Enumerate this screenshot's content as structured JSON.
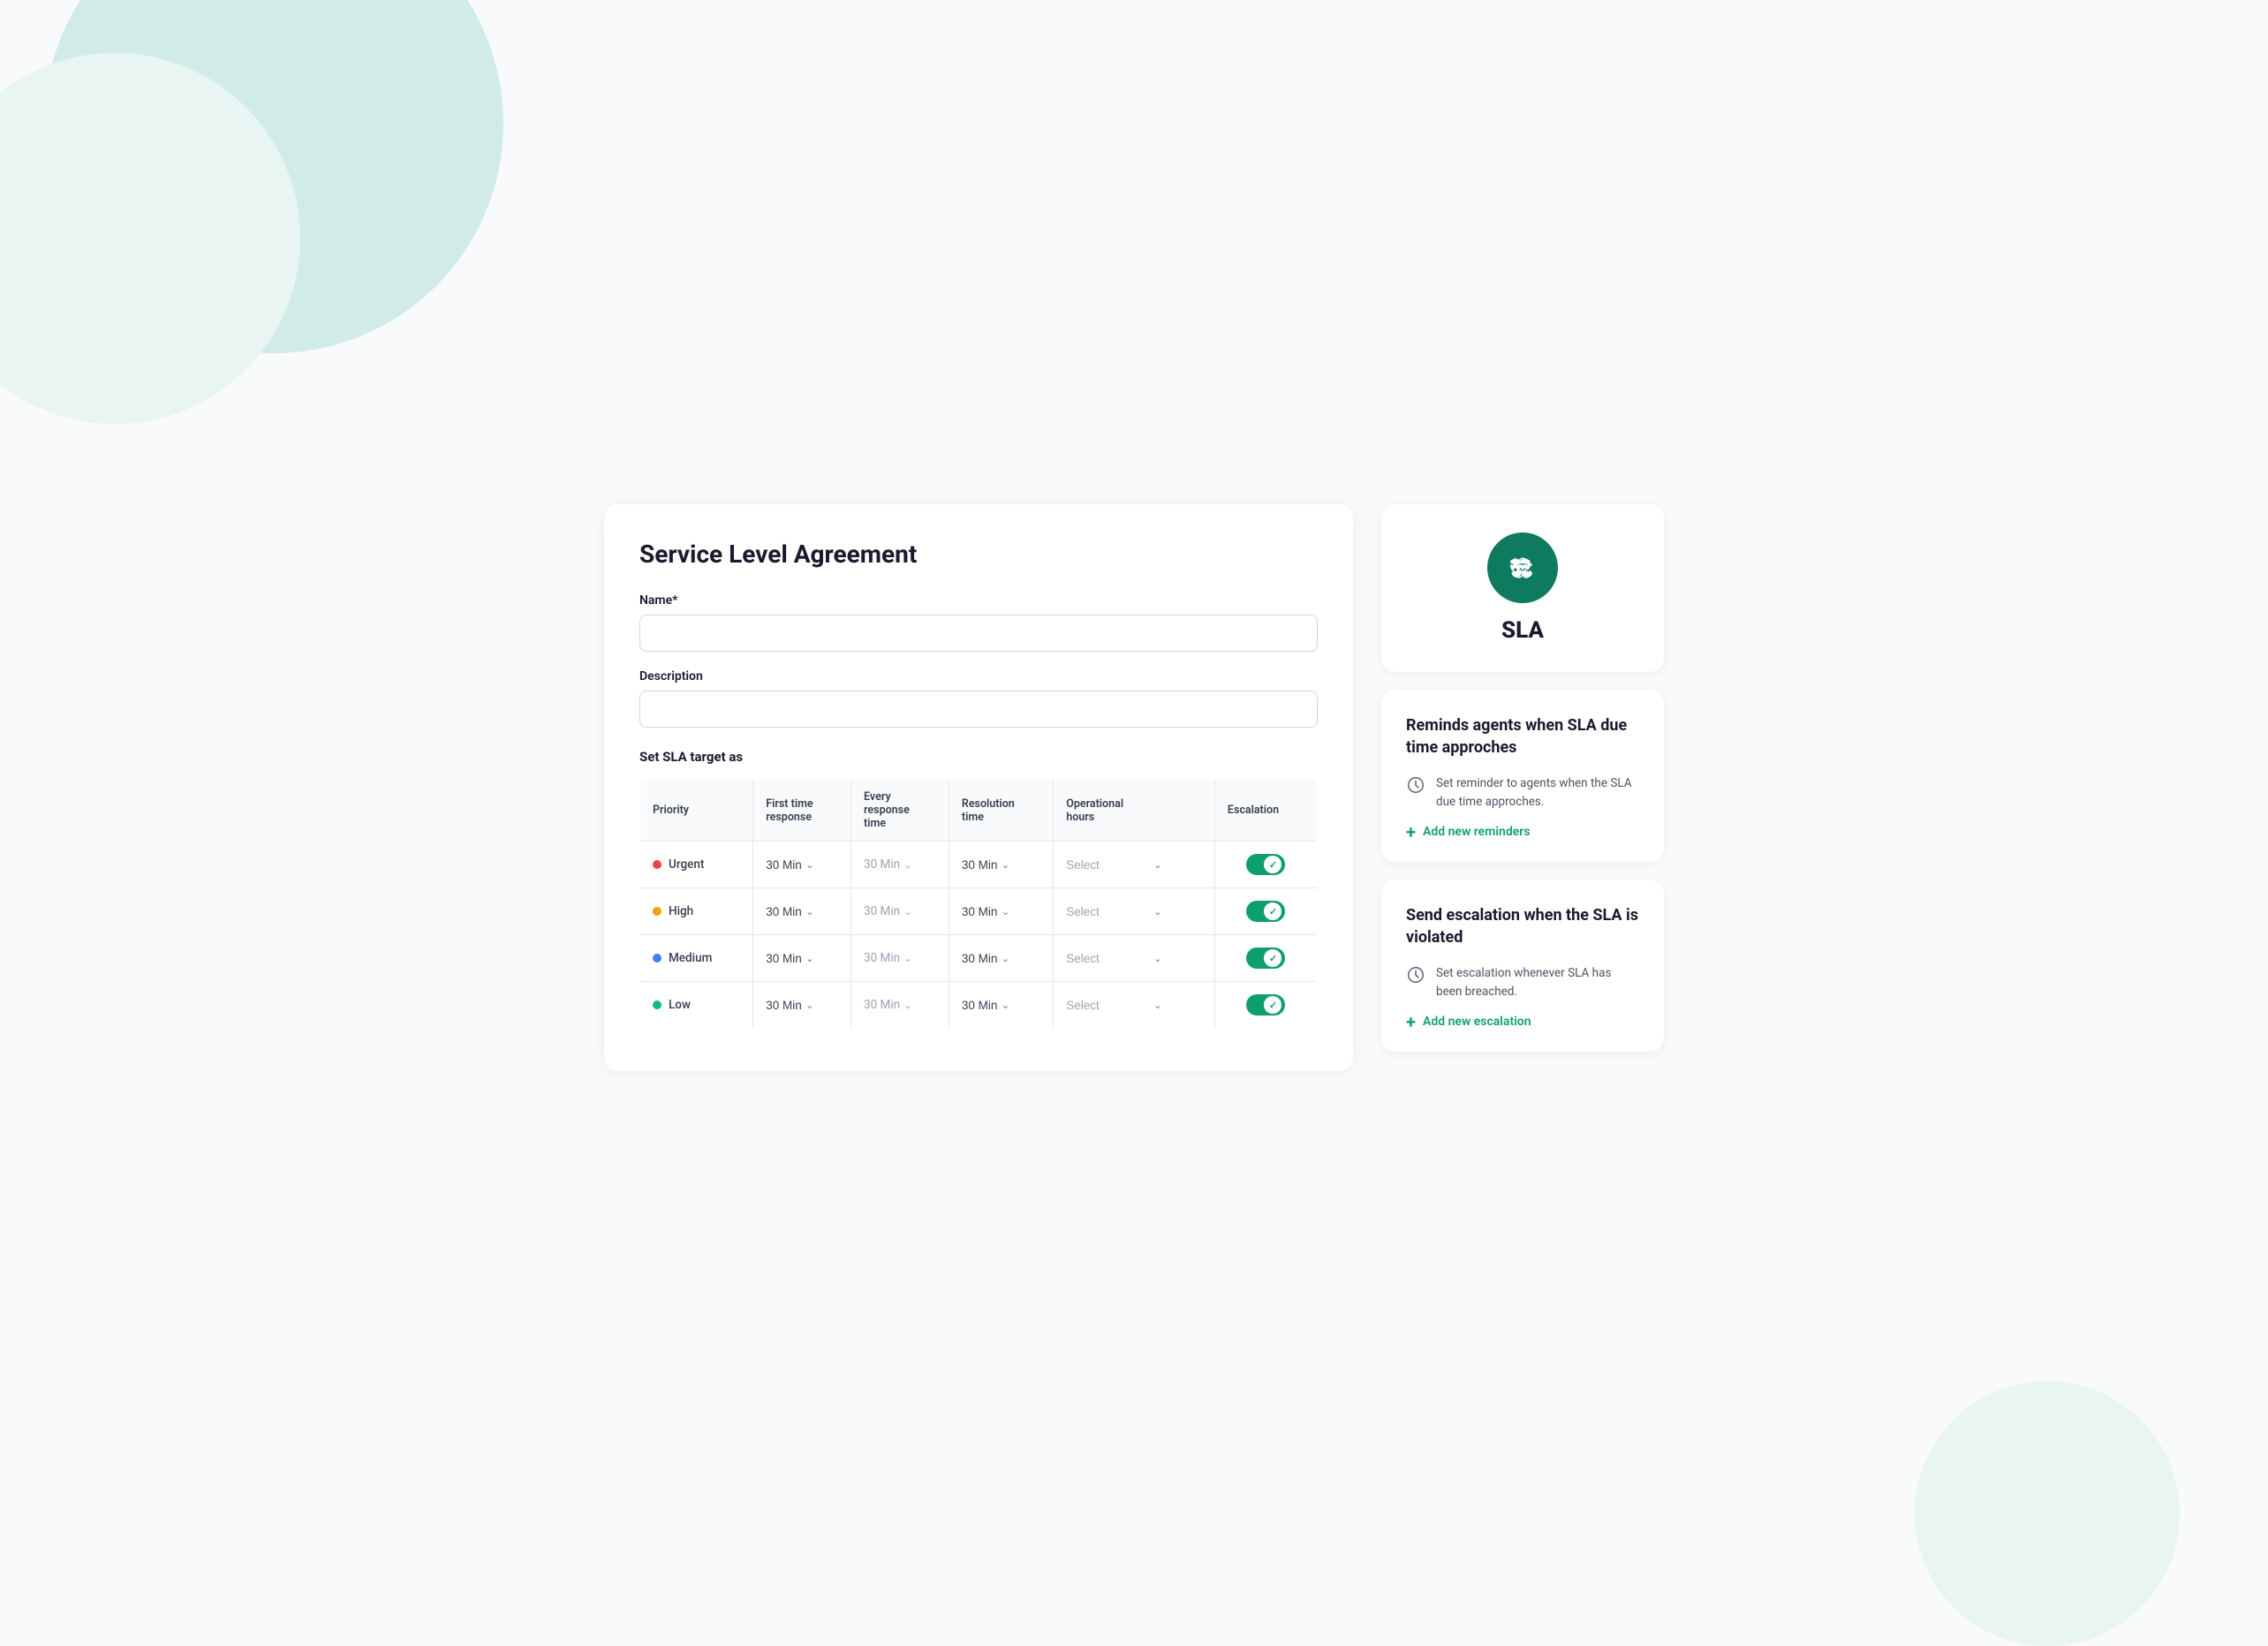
{
  "background": {
    "circle_top_color": "#d1ece8",
    "circle_left_color": "#e8f5f2",
    "circle_bottom_right_color": "#e8f5f2"
  },
  "left_panel": {
    "title": "Service Level Agreement",
    "name_label": "Name*",
    "name_placeholder": "",
    "description_label": "Description",
    "description_placeholder": "",
    "sla_section_label": "Set SLA target as",
    "table": {
      "headers": [
        "Priority",
        "First time response",
        "Every response time",
        "Resolution time",
        "Operational hours",
        "Escalation"
      ],
      "rows": [
        {
          "priority": "Urgent",
          "priority_color": "#ef4444",
          "first_response": "30 Min",
          "every_response": "30 Min",
          "resolution": "30 Min",
          "operational": "Select",
          "escalation_on": true
        },
        {
          "priority": "High",
          "priority_color": "#f59e0b",
          "first_response": "30 Min",
          "every_response": "30 Min",
          "resolution": "30 Min",
          "operational": "Select",
          "escalation_on": true
        },
        {
          "priority": "Medium",
          "priority_color": "#3b82f6",
          "first_response": "30 Min",
          "every_response": "30 Min",
          "resolution": "30 Min",
          "operational": "Select",
          "escalation_on": true
        },
        {
          "priority": "Low",
          "priority_color": "#10b981",
          "first_response": "30 Min",
          "every_response": "30 Min",
          "resolution": "30 Min",
          "operational": "Select",
          "escalation_on": true
        }
      ]
    }
  },
  "right_panel": {
    "sla_card": {
      "label": "SLA"
    },
    "reminders_card": {
      "title": "Reminds agents when SLA due time approches",
      "description": "Set reminder to agents when the SLA due time approches.",
      "add_link": "Add new reminders"
    },
    "escalation_card": {
      "title": "Send escalation when the SLA is violated",
      "description": "Set escalation whenever SLA has been breached.",
      "add_link": "Add new escalation"
    }
  }
}
